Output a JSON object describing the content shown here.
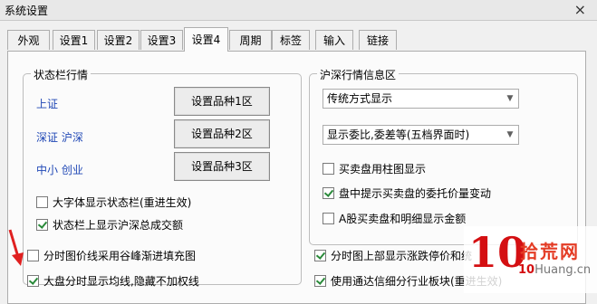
{
  "window": {
    "title": "系统设置",
    "close_label": "×"
  },
  "tabs": [
    {
      "label": "外观"
    },
    {
      "label": "设置1"
    },
    {
      "label": "设置2"
    },
    {
      "label": "设置3"
    },
    {
      "label": "设置4",
      "active": true
    },
    {
      "label": "周期"
    },
    {
      "label": "标签"
    },
    {
      "label": "输入"
    },
    {
      "label": "链接"
    }
  ],
  "status_group": {
    "legend": "状态栏行情",
    "rows": [
      {
        "label": "上证",
        "button": "设置品种1区"
      },
      {
        "label": "深证 沪深",
        "button": "设置品种2区"
      },
      {
        "label": "中小 创业",
        "button": "设置品种3区"
      }
    ],
    "checkboxes": [
      {
        "label": "大字体显示状态栏(重进生效)",
        "checked": false
      },
      {
        "label": "状态栏上显示沪深总成交额",
        "checked": true
      }
    ]
  },
  "hushen_group": {
    "legend": "沪深行情信息区",
    "select1": "传统方式显示",
    "select2": "显示委比,委差等(五档界面时)",
    "checkboxes": [
      {
        "label": "买卖盘用柱图显示",
        "checked": false
      },
      {
        "label": "盘中提示买卖盘的委托价量变动",
        "checked": true
      },
      {
        "label": "A股买卖盘和明细显示金额",
        "checked": false
      }
    ]
  },
  "bottom": {
    "left": [
      {
        "label": "分时图价线采用谷峰渐进填充图",
        "checked": false
      },
      {
        "label": "大盘分时显示均线,隐藏不加权线",
        "checked": true
      }
    ],
    "right": [
      {
        "label": "分时图上部显示涨跌停价和统",
        "checked": true
      },
      {
        "label": "使用通达信细分行业板块(重进生效)",
        "checked": true
      }
    ]
  },
  "watermark": {
    "logo": "10",
    "text": "拾荒网",
    "domain_prefix": "10",
    "domain_rest": "Huang.cn"
  },
  "colors": {
    "blue_label": "#1f47b5",
    "check": "#2a8a3a",
    "arrow": "#e02020"
  }
}
